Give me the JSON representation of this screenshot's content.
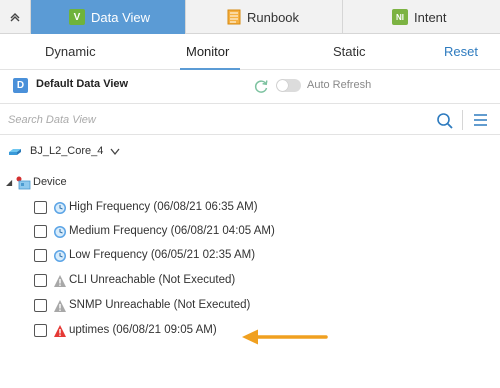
{
  "top_tabs": [
    {
      "label": "Data View",
      "badge": "V",
      "badge_color": "#6fb33c",
      "active": true
    },
    {
      "label": "Runbook",
      "badge": "",
      "badge_color": "#f0a030",
      "active": false
    },
    {
      "label": "Intent",
      "badge": "NI",
      "badge_color": "#7cb342",
      "active": false
    }
  ],
  "sub_tabs": [
    "Dynamic",
    "Monitor",
    "Static"
  ],
  "reset_label": "Reset",
  "data_view": {
    "icon_letter": "D",
    "title": "Default Data View",
    "auto_refresh_label": "Auto Refresh",
    "auto_refresh_on": false
  },
  "search": {
    "placeholder": "Search Data View"
  },
  "device_group": {
    "label": "BJ_L2_Core_4"
  },
  "tree": {
    "root_label": "Device",
    "items": [
      {
        "label": "High Frequency (06/08/21 06:35 AM)",
        "icon": "clock-icon"
      },
      {
        "label": "Medium Frequency (06/08/21 04:05 AM)",
        "icon": "clock-icon"
      },
      {
        "label": "Low Frequency (06/05/21 02:35 AM)",
        "icon": "clock-icon"
      },
      {
        "label": "CLI Unreachable (Not Executed)",
        "icon": "warning-gray-icon"
      },
      {
        "label": "SNMP Unreachable (Not Executed)",
        "icon": "warning-gray-icon"
      },
      {
        "label": "uptimes (06/08/21 09:05 AM)",
        "icon": "warning-red-icon"
      }
    ]
  },
  "colors": {
    "accent": "#5b9bd5",
    "link": "#2e7bbf",
    "arrow": "#f0a020",
    "warning_red": "#e53935",
    "warning_gray": "#9e9e9e"
  }
}
